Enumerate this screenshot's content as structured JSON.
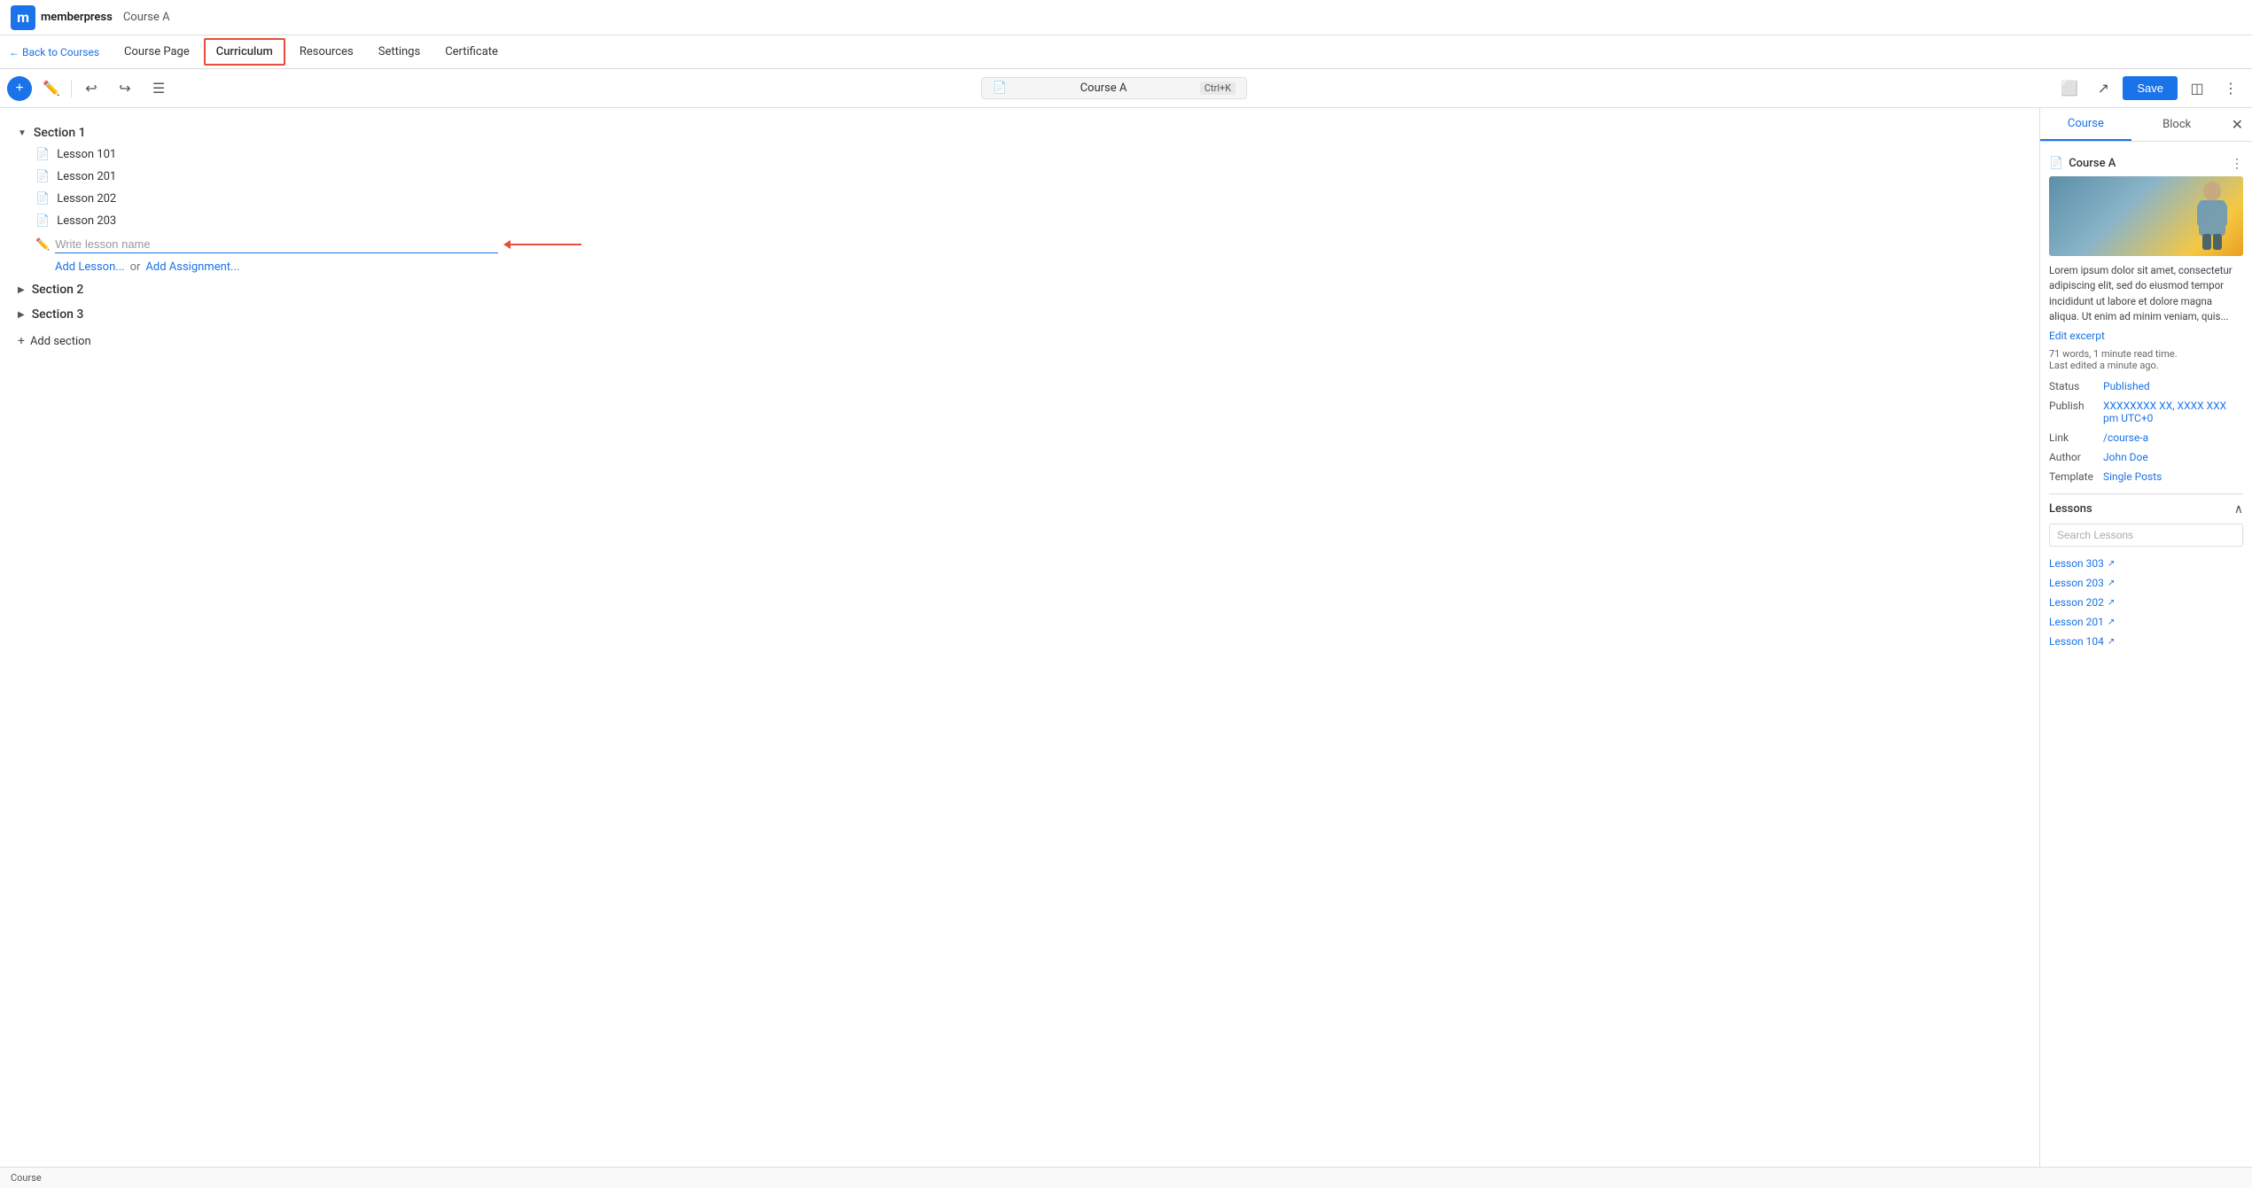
{
  "header": {
    "logo_letter": "m",
    "brand": "memberpress",
    "course_title": "Course A"
  },
  "nav": {
    "back_label": "← Back to Courses",
    "tabs": [
      {
        "id": "course-page",
        "label": "Course Page",
        "active": false
      },
      {
        "id": "curriculum",
        "label": "Curriculum",
        "active": true
      },
      {
        "id": "resources",
        "label": "Resources",
        "active": false
      },
      {
        "id": "settings",
        "label": "Settings",
        "active": false
      },
      {
        "id": "certificate",
        "label": "Certificate",
        "active": false
      }
    ]
  },
  "toolbar": {
    "title_field": "Course A",
    "shortcut": "Ctrl+K",
    "save_label": "Save"
  },
  "curriculum": {
    "sections": [
      {
        "id": "section-1",
        "label": "Section 1",
        "expanded": true,
        "lessons": [
          {
            "id": "lesson-101",
            "label": "Lesson 101"
          },
          {
            "id": "lesson-201",
            "label": "Lesson 201"
          },
          {
            "id": "lesson-202",
            "label": "Lesson 202"
          },
          {
            "id": "lesson-203",
            "label": "Lesson 203"
          }
        ],
        "new_lesson_placeholder": "Write lesson name",
        "add_lesson_label": "Add Lesson...",
        "add_lesson_or": "or",
        "add_assignment_label": "Add Assignment..."
      },
      {
        "id": "section-2",
        "label": "Section 2",
        "expanded": false
      },
      {
        "id": "section-3",
        "label": "Section 3",
        "expanded": false
      }
    ],
    "add_section_label": "Add section"
  },
  "right_panel": {
    "tabs": [
      {
        "id": "course",
        "label": "Course",
        "active": true
      },
      {
        "id": "block",
        "label": "Block",
        "active": false
      }
    ],
    "course": {
      "title": "Course A",
      "description": "Lorem ipsum dolor sit amet, consectetur adipiscing elit, sed do eiusmod tempor incididunt ut labore et dolore magna aliqua. Ut enim ad minim veniam, quis...",
      "edit_excerpt": "Edit excerpt",
      "word_count": "71 words, 1 minute read time.",
      "last_edited": "Last edited a minute ago.",
      "status_label": "Status",
      "status_value": "Published",
      "publish_label": "Publish",
      "publish_value": "XXXXXXXX XX, XXXX XXX pm UTC+0",
      "link_label": "Link",
      "link_value": "/course-a",
      "author_label": "Author",
      "author_value": "John Doe",
      "template_label": "Template",
      "template_value": "Single Posts"
    },
    "lessons": {
      "title": "Lessons",
      "search_placeholder": "Search Lessons",
      "items": [
        {
          "label": "Lesson 303"
        },
        {
          "label": "Lesson 203"
        },
        {
          "label": "Lesson 202"
        },
        {
          "label": "Lesson 201"
        },
        {
          "label": "Lesson 104"
        }
      ]
    }
  },
  "status_bar": {
    "label": "Course"
  }
}
